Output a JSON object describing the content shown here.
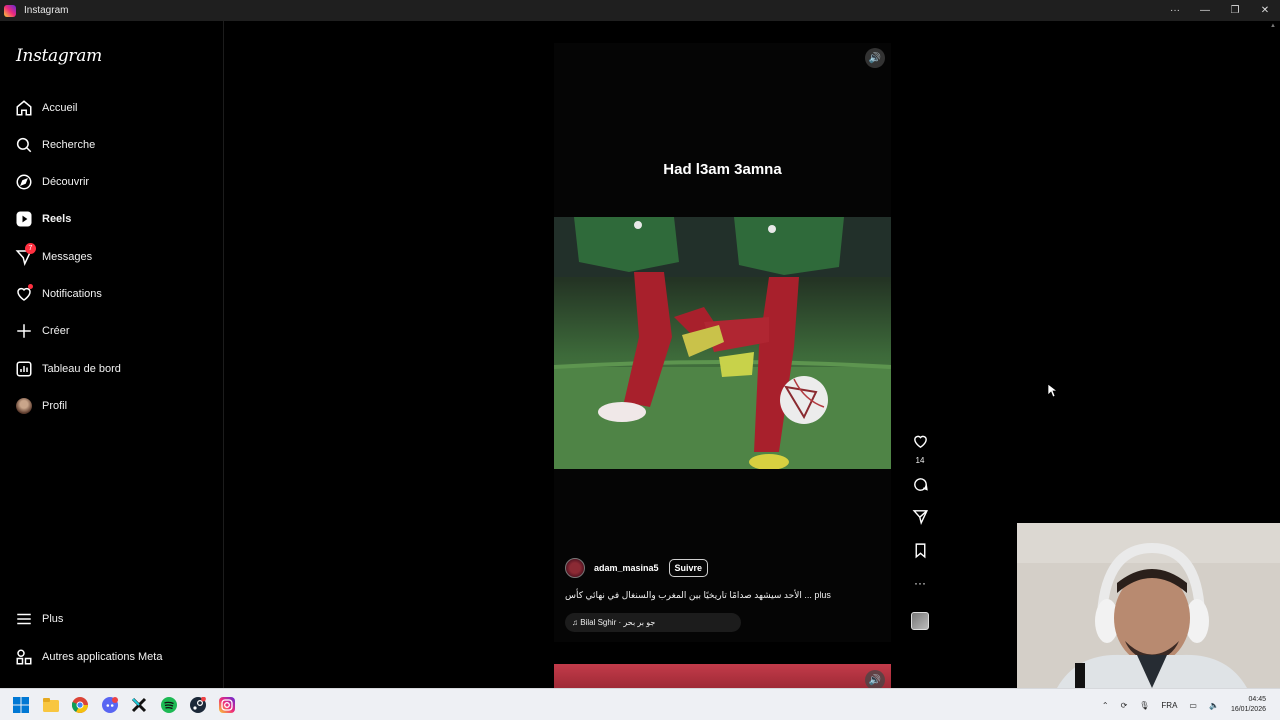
{
  "window": {
    "title": "Instagram",
    "controls": [
      "more",
      "minimize",
      "restore",
      "close"
    ]
  },
  "sidebar": {
    "logo": "Instagram",
    "items": [
      {
        "id": "home",
        "label": "Accueil",
        "icon": "home-icon"
      },
      {
        "id": "search",
        "label": "Recherche",
        "icon": "search-icon"
      },
      {
        "id": "explore",
        "label": "Découvrir",
        "icon": "compass-icon"
      },
      {
        "id": "reels",
        "label": "Reels",
        "icon": "reels-icon",
        "active": true
      },
      {
        "id": "messages",
        "label": "Messages",
        "icon": "messenger-icon",
        "badge": "7"
      },
      {
        "id": "notifications",
        "label": "Notifications",
        "icon": "heart-icon",
        "dot": true
      },
      {
        "id": "create",
        "label": "Créer",
        "icon": "plus-icon"
      },
      {
        "id": "dashboard",
        "label": "Tableau de bord",
        "icon": "dashboard-icon"
      },
      {
        "id": "profile",
        "label": "Profil",
        "icon": "avatar"
      }
    ],
    "bottom_items": [
      {
        "id": "more",
        "label": "Plus",
        "icon": "menu-icon"
      },
      {
        "id": "meta",
        "label": "Autres applications Meta",
        "icon": "meta-apps-icon"
      }
    ]
  },
  "reel": {
    "overlay_text": "Had l3am 3amna",
    "author": "adam_masina5",
    "follow_label": "Suivre",
    "description": "الأحد سيشهد صدامًا تاريخيًا بين المغرب والسنغال في نهائي كأس ... plus",
    "music": "♫ Bilal Sghir · جو بر بحر",
    "likes": "14",
    "sound_icon": "speaker-icon"
  },
  "actions": [
    {
      "id": "like",
      "icon": "heart-icon",
      "count": "14"
    },
    {
      "id": "comment",
      "icon": "comment-icon"
    },
    {
      "id": "share",
      "icon": "send-icon"
    },
    {
      "id": "save",
      "icon": "bookmark-icon"
    },
    {
      "id": "more",
      "icon": "more-icon"
    },
    {
      "id": "audio",
      "icon": "audio-thumbnail"
    }
  ],
  "taskbar": {
    "apps": [
      "windows-start-icon",
      "file-explorer-icon",
      "chrome-icon",
      "discord-icon",
      "capcut-icon",
      "spotify-icon",
      "steam-icon",
      "instagram-icon"
    ],
    "language": "FRA",
    "time": "04:45",
    "date": "16/01/2026"
  }
}
